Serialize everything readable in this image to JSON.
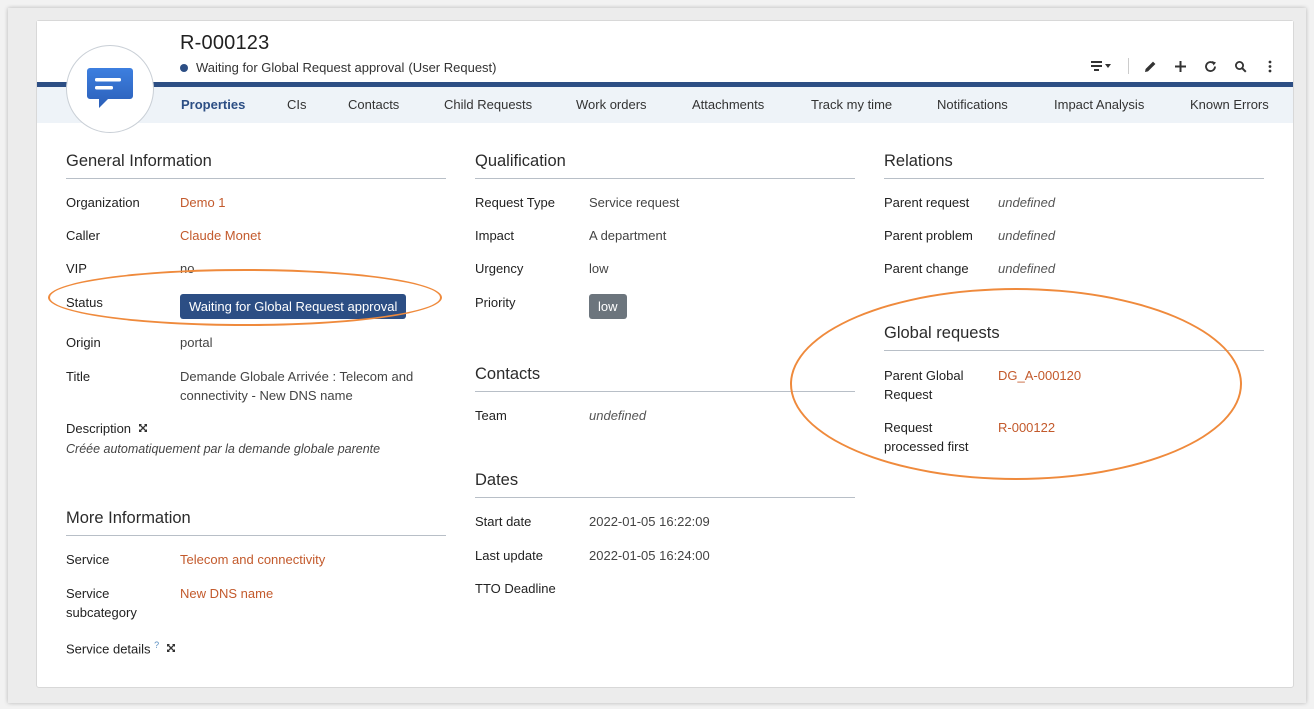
{
  "header": {
    "ref": "R-000123",
    "status": "Waiting for Global Request approval",
    "type": "(User Request)",
    "status_color": "#2c4e84",
    "icon": "chat-message-icon",
    "actions": [
      "list-icon",
      "pencil-icon",
      "plus-icon",
      "refresh-icon",
      "search-icon",
      "more-icon"
    ]
  },
  "tabs": [
    "Properties",
    "CIs",
    "Contacts",
    "Child Requests",
    "Work orders",
    "Attachments",
    "Track my time",
    "Notifications",
    "Impact Analysis",
    "Known Errors"
  ],
  "general": {
    "title": "General Information",
    "organization_label": "Organization",
    "organization": "Demo 1",
    "caller_label": "Caller",
    "caller": "Claude Monet",
    "vip_label": "VIP",
    "vip": "no",
    "status_label": "Status",
    "status": "Waiting for Global Request approval",
    "origin_label": "Origin",
    "origin": "portal",
    "title_label": "Title",
    "title_line1": "Demande Globale Arrivée : Telecom and",
    "title_line2": "connectivity - New DNS name",
    "description_label": "Description",
    "description": "Créée automatiquement par la demande globale parente"
  },
  "more": {
    "title": "More Information",
    "service_label": "Service",
    "service": "Telecom and connectivity",
    "subcategory_label_1": "Service",
    "subcategory_label_2": "subcategory",
    "subcategory": "New DNS name",
    "details_label": "Service details",
    "details_hint": "?"
  },
  "qualification": {
    "title": "Qualification",
    "request_type_label": "Request Type",
    "request_type": "Service request",
    "impact_label": "Impact",
    "impact": "A department",
    "urgency_label": "Urgency",
    "urgency": "low",
    "priority_label": "Priority",
    "priority": "low"
  },
  "contacts": {
    "title": "Contacts",
    "team_label": "Team",
    "team": "undefined"
  },
  "dates": {
    "title": "Dates",
    "start_label": "Start date",
    "start": "2022-01-05 16:22:09",
    "update_label": "Last update",
    "update": "2022-01-05 16:24:00",
    "tto_label": "TTO Deadline"
  },
  "relations": {
    "title": "Relations",
    "parent_request_label": "Parent request",
    "parent_request": "undefined",
    "parent_problem_label": "Parent problem",
    "parent_problem": "undefined",
    "parent_change_label": "Parent change",
    "parent_change": "undefined"
  },
  "global": {
    "title": "Global requests",
    "parent_label_1": "Parent Global",
    "parent_label_2": "Request",
    "parent": "DG_A-000120",
    "first_label_1": "Request",
    "first_label_2": "processed first",
    "first": "R-000122"
  },
  "colors": {
    "accent": "#2c4e84",
    "link": "#c35a2c",
    "highlight": "#ef8a3c"
  }
}
